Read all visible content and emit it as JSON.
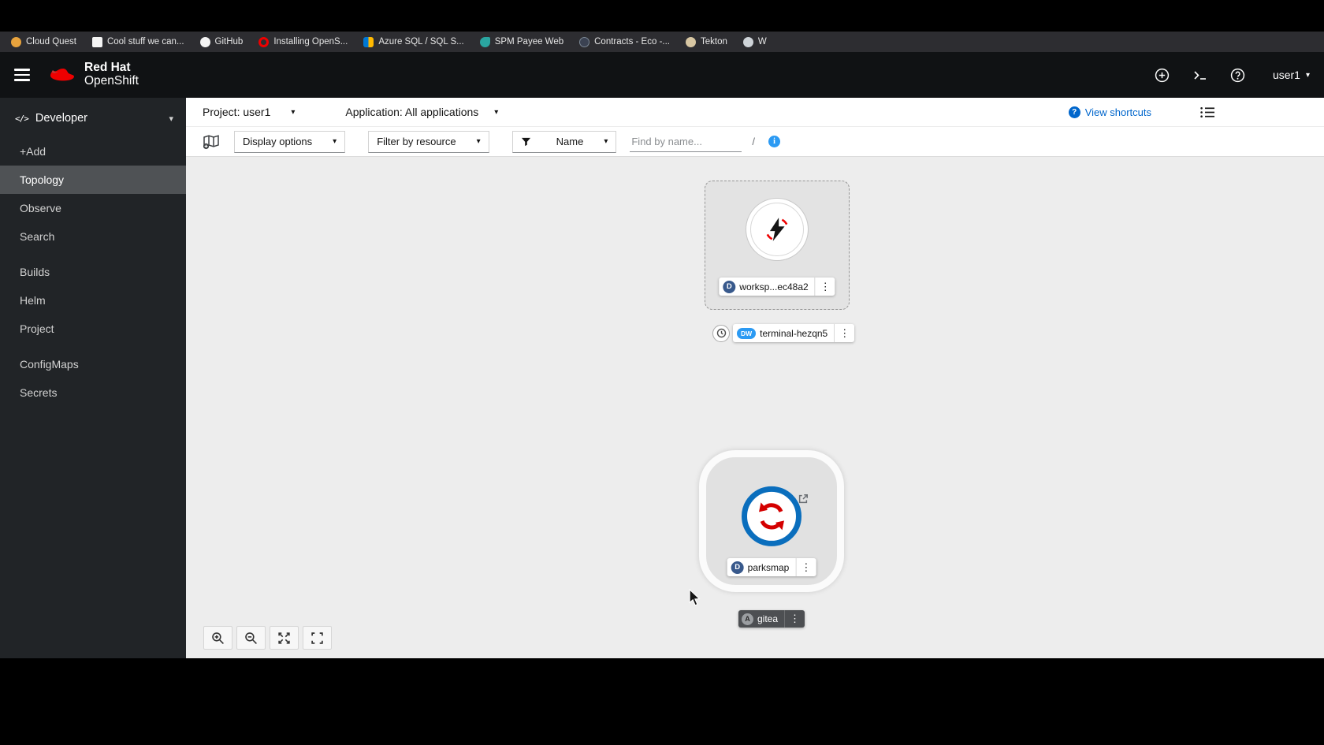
{
  "icons": {
    "caret_down": "▾",
    "kebab": "⋮",
    "code": "</>"
  },
  "bookmarks": {
    "items": [
      {
        "label": "Cloud Quest"
      },
      {
        "label": "Cool stuff we can..."
      },
      {
        "label": "GitHub"
      },
      {
        "label": "Installing OpenS..."
      },
      {
        "label": "Azure SQL / SQL S..."
      },
      {
        "label": "SPM Payee Web"
      },
      {
        "label": "Contracts - Eco -..."
      },
      {
        "label": "Tekton"
      },
      {
        "label": "W"
      }
    ]
  },
  "masthead": {
    "brand_top": "Red Hat",
    "brand_bottom": "OpenShift",
    "user_menu": "user1"
  },
  "sidebar": {
    "perspective": "Developer",
    "selected": "Topology",
    "items": [
      {
        "label": "+Add"
      },
      {
        "label": "Topology"
      },
      {
        "label": "Observe"
      },
      {
        "label": "Search"
      },
      {
        "label": "Builds"
      },
      {
        "label": "Helm"
      },
      {
        "label": "Project"
      },
      {
        "label": "ConfigMaps"
      },
      {
        "label": "Secrets"
      }
    ]
  },
  "context_bar": {
    "project": "Project: user1",
    "application": "Application: All applications",
    "view_shortcuts": "View shortcuts"
  },
  "topology_toolbar": {
    "display_options": "Display options",
    "filter_by_resource": "Filter by resource",
    "name_filter": "Name",
    "find_placeholder": "Find by name...",
    "shortcut_key": "/",
    "info": "i"
  },
  "topology": {
    "workspace_node": {
      "badge": "D",
      "label": "worksp...ec48a2"
    },
    "terminal_node": {
      "badge": "DW",
      "label": "terminal-hezqn5"
    },
    "parksmap_node": {
      "badge": "D",
      "label": "parksmap"
    },
    "gitea_node": {
      "badge": "A",
      "label": "gitea"
    }
  },
  "colors": {
    "accent_blue": "#0066cc",
    "deployment_badge": "#38598c",
    "devworkspace_badge": "#2b9af3",
    "app_badge": "#9b9ea1",
    "openshift_red": "#ee0000"
  }
}
